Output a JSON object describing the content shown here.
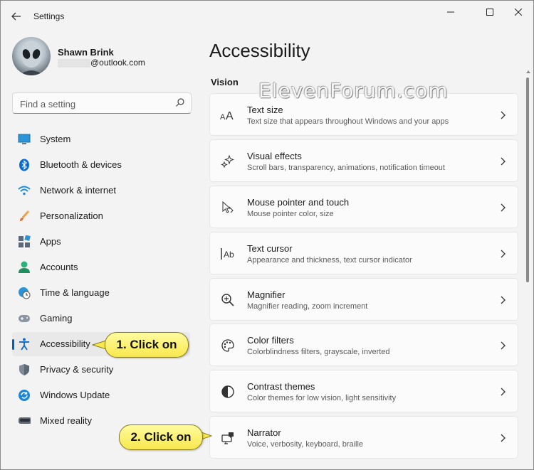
{
  "window": {
    "title": "Settings"
  },
  "account": {
    "name": "Shawn Brink",
    "email_suffix": "@outlook.com"
  },
  "search": {
    "placeholder": "Find a setting"
  },
  "nav": {
    "items": [
      {
        "label": "System",
        "icon": "monitor-icon"
      },
      {
        "label": "Bluetooth & devices",
        "icon": "bluetooth-icon"
      },
      {
        "label": "Network & internet",
        "icon": "wifi-icon"
      },
      {
        "label": "Personalization",
        "icon": "brush-icon"
      },
      {
        "label": "Apps",
        "icon": "apps-icon"
      },
      {
        "label": "Accounts",
        "icon": "person-icon"
      },
      {
        "label": "Time & language",
        "icon": "globe-clock-icon"
      },
      {
        "label": "Gaming",
        "icon": "gamepad-icon"
      },
      {
        "label": "Accessibility",
        "icon": "accessibility-icon",
        "selected": true
      },
      {
        "label": "Privacy & security",
        "icon": "shield-icon"
      },
      {
        "label": "Windows Update",
        "icon": "sync-icon"
      },
      {
        "label": "Mixed reality",
        "icon": "vr-headset-icon"
      }
    ]
  },
  "main": {
    "title": "Accessibility",
    "section": "Vision",
    "watermark": "ElevenForum.com",
    "cards": [
      {
        "title": "Text size",
        "subtitle": "Text size that appears throughout Windows and your apps",
        "icon": "text-size-icon"
      },
      {
        "title": "Visual effects",
        "subtitle": "Scroll bars, transparency, animations, notification timeout",
        "icon": "sparkle-icon"
      },
      {
        "title": "Mouse pointer and touch",
        "subtitle": "Mouse pointer color, size",
        "icon": "pointer-icon"
      },
      {
        "title": "Text cursor",
        "subtitle": "Appearance and thickness, text cursor indicator",
        "icon": "text-cursor-icon"
      },
      {
        "title": "Magnifier",
        "subtitle": "Magnifier reading, zoom increment",
        "icon": "magnifier-icon"
      },
      {
        "title": "Color filters",
        "subtitle": "Colorblindness filters, grayscale, inverted",
        "icon": "palette-icon"
      },
      {
        "title": "Contrast themes",
        "subtitle": "Color themes for low vision, light sensitivity",
        "icon": "contrast-icon"
      },
      {
        "title": "Narrator",
        "subtitle": "Voice, verbosity, keyboard, braille",
        "icon": "narrator-icon"
      }
    ]
  },
  "callouts": {
    "step1": "1. Click on",
    "step2": "2. Click on"
  },
  "colors": {
    "accent": "#005fb8",
    "callout": "#f8e84c"
  }
}
